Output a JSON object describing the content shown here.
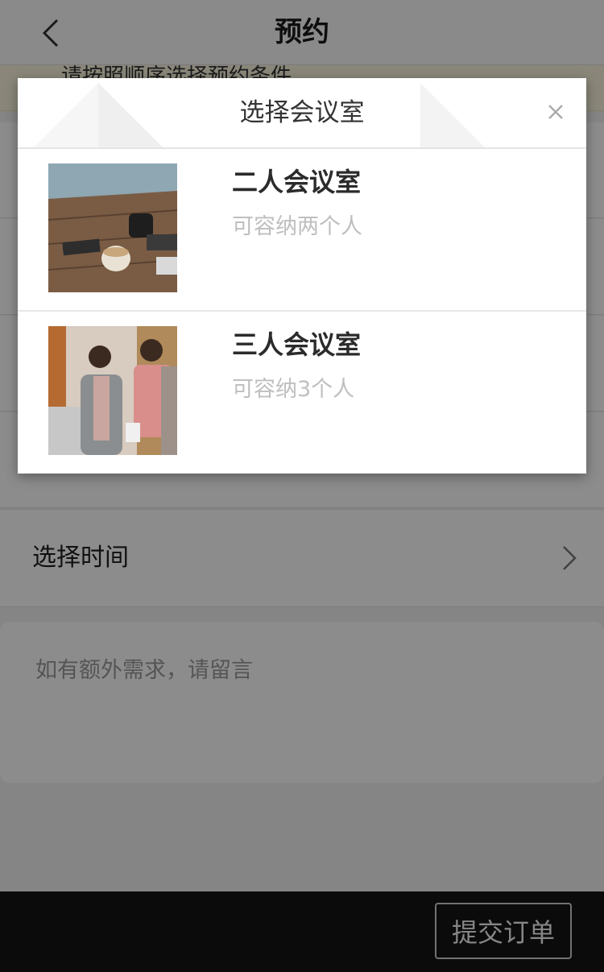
{
  "header": {
    "title": "预约"
  },
  "notice": {
    "text": "请按照顺序选择预约条件"
  },
  "form": {
    "time_label": "选择时间",
    "remark_placeholder": "如有额外需求，请留言"
  },
  "footer": {
    "submit_label": "提交订单"
  },
  "modal": {
    "title": "选择会议室",
    "rooms": [
      {
        "name": "二人会议室",
        "capacity": "可容纳两个人",
        "thumb": "desk-coffee-photo"
      },
      {
        "name": "三人会议室",
        "capacity": "可容纳3个人",
        "thumb": "people-meeting-photo"
      }
    ]
  },
  "colors": {
    "overlay": "#000000",
    "footer_bg": "#141414",
    "notice_bg": "#fbf6de"
  }
}
